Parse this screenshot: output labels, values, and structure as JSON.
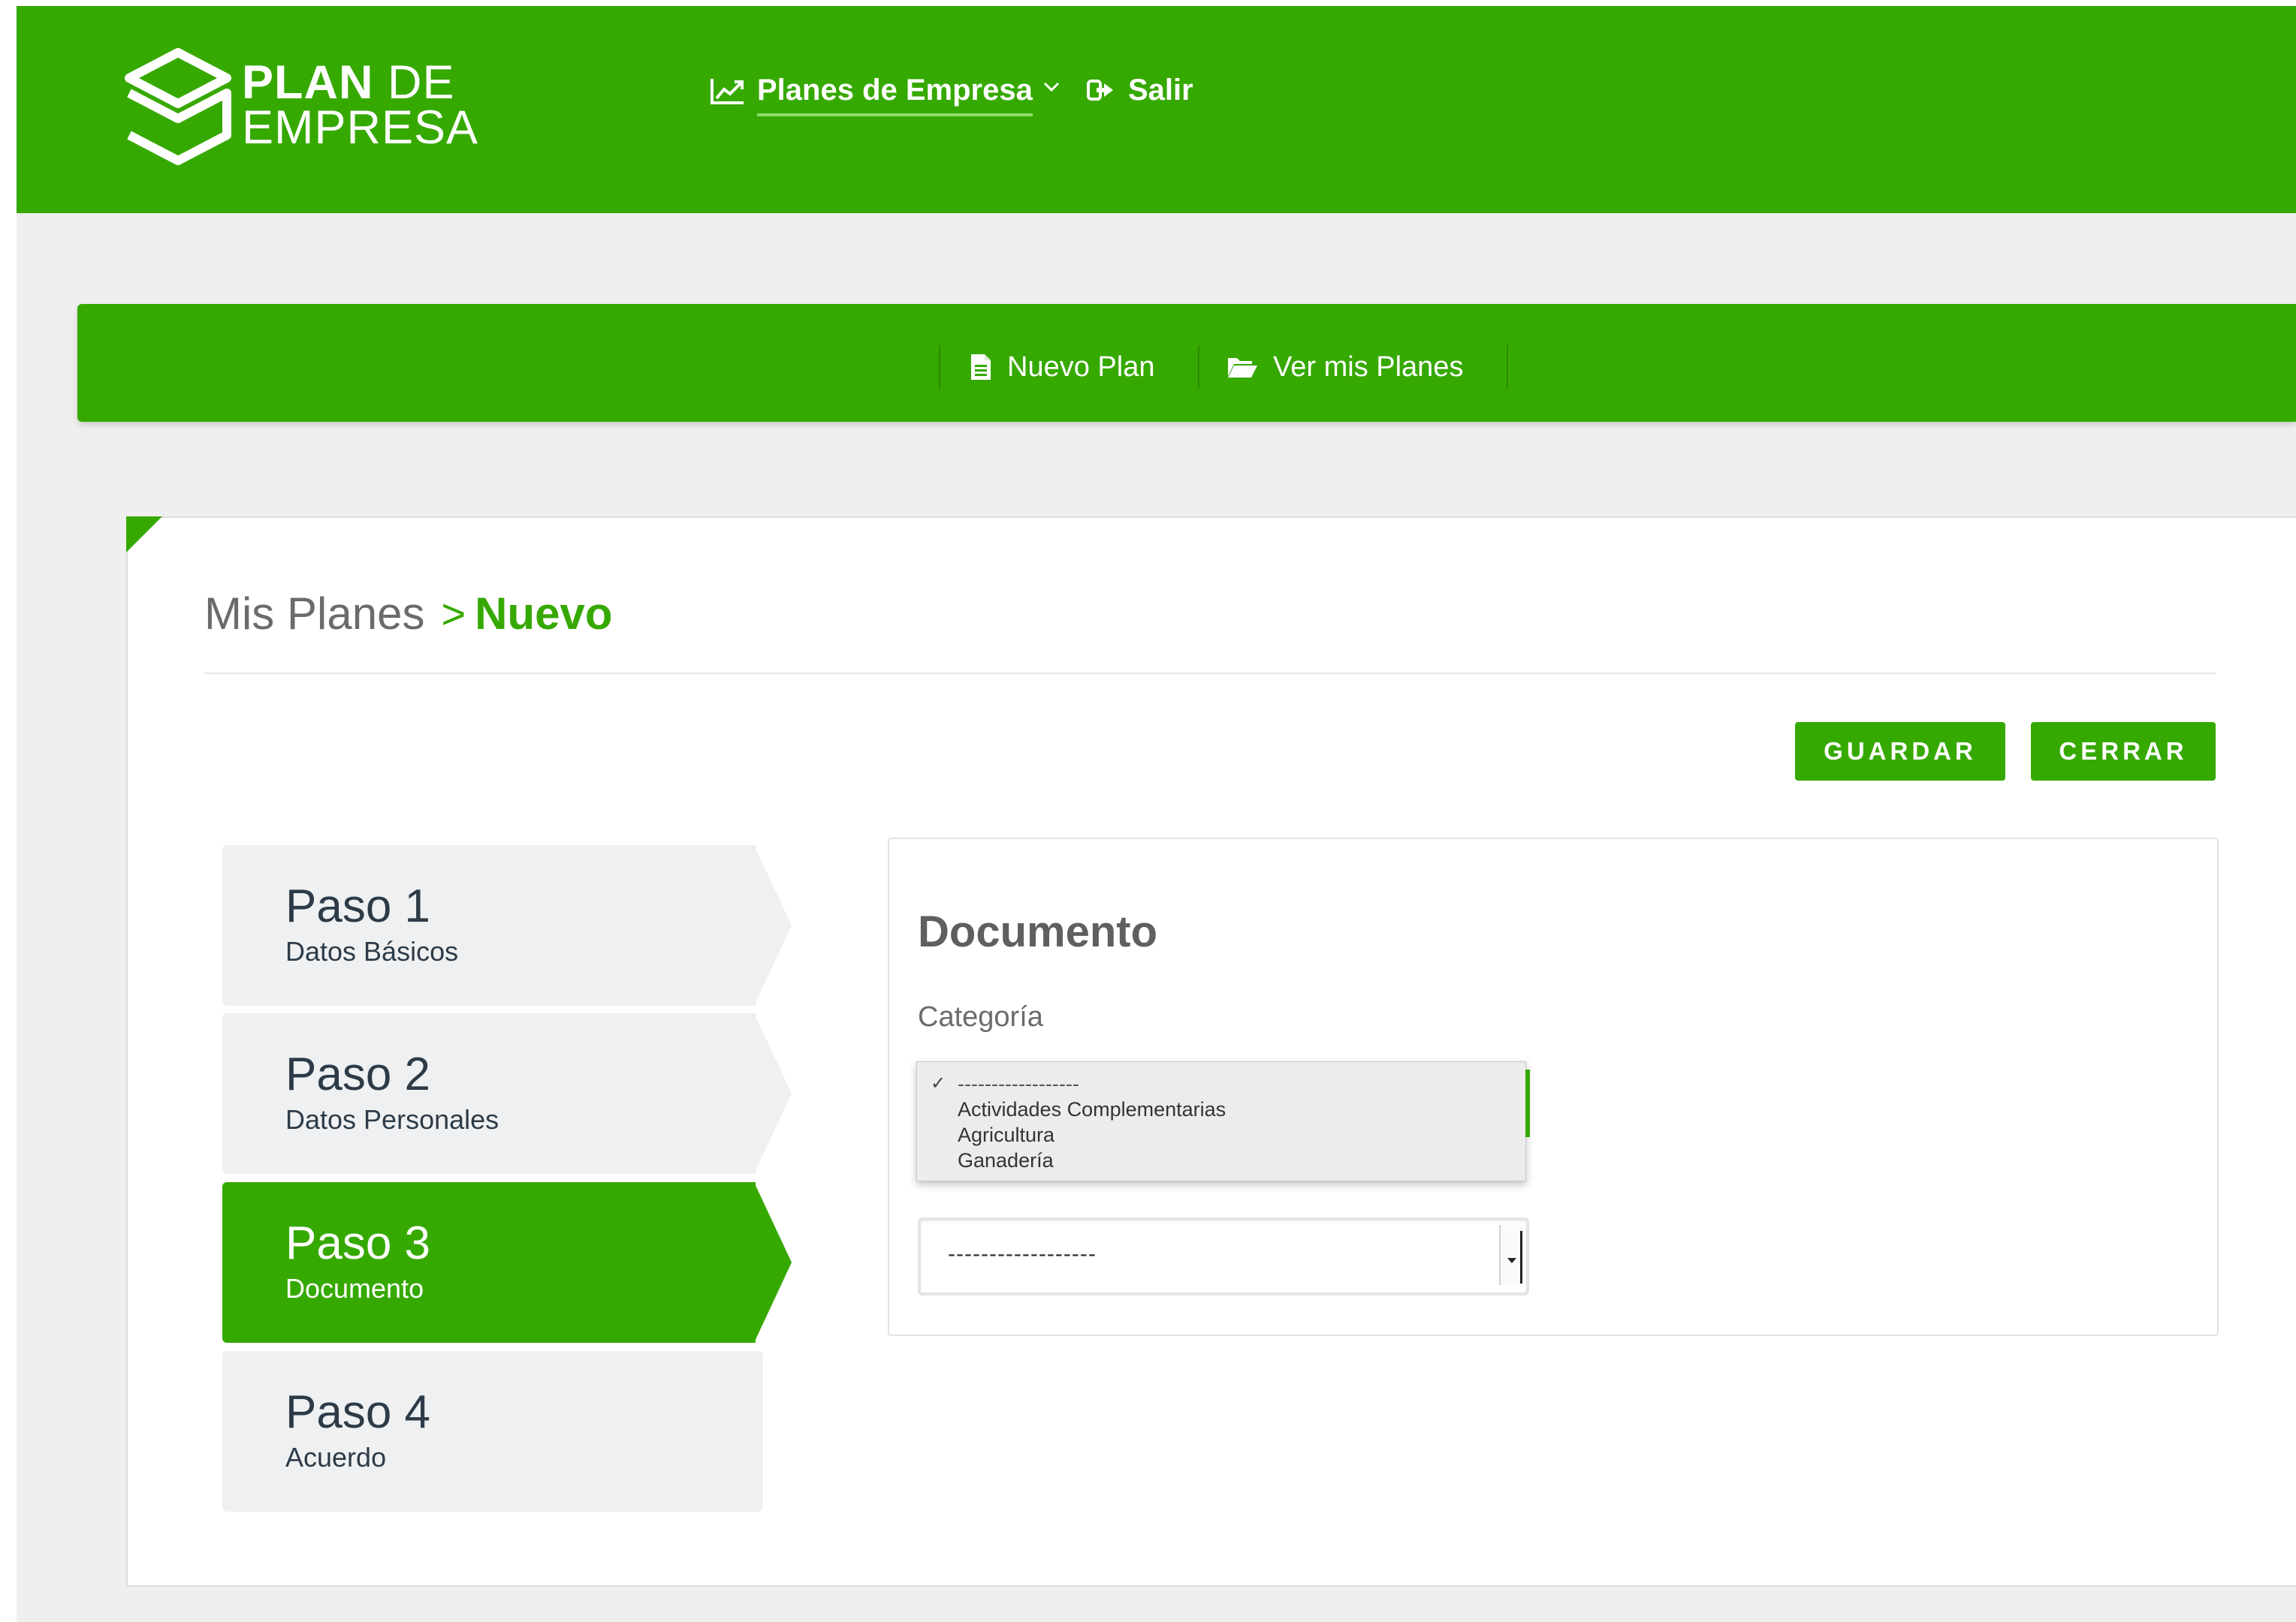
{
  "brand": {
    "line1_bold": "PLAN",
    "line1_light": "DE",
    "line2": "EMPRESA"
  },
  "topnav": {
    "plans_label": "Planes de Empresa",
    "exit_label": "Salir"
  },
  "subnav": {
    "new_plan": "Nuevo Plan",
    "my_plans": "Ver mis Planes"
  },
  "breadcrumb": {
    "parent": "Mis Planes",
    "separator": ">",
    "current": "Nuevo"
  },
  "actions": {
    "save": "GUARDAR",
    "close": "CERRAR"
  },
  "steps": [
    {
      "title": "Paso 1",
      "subtitle": "Datos Básicos",
      "active": false
    },
    {
      "title": "Paso 2",
      "subtitle": "Datos Personales",
      "active": false
    },
    {
      "title": "Paso 3",
      "subtitle": "Documento",
      "active": true
    },
    {
      "title": "Paso 4",
      "subtitle": "Acuerdo",
      "active": false
    }
  ],
  "panel": {
    "title": "Documento",
    "category_label": "Categoría",
    "check_mark": "✓",
    "options": [
      "------------------",
      "Actividades Complementarias",
      "Agricultura",
      "Ganadería"
    ],
    "selected_value": "------------------"
  },
  "colors": {
    "primary": "#36a900",
    "page_bg": "#efefef",
    "step_bg": "#eff0f1"
  }
}
